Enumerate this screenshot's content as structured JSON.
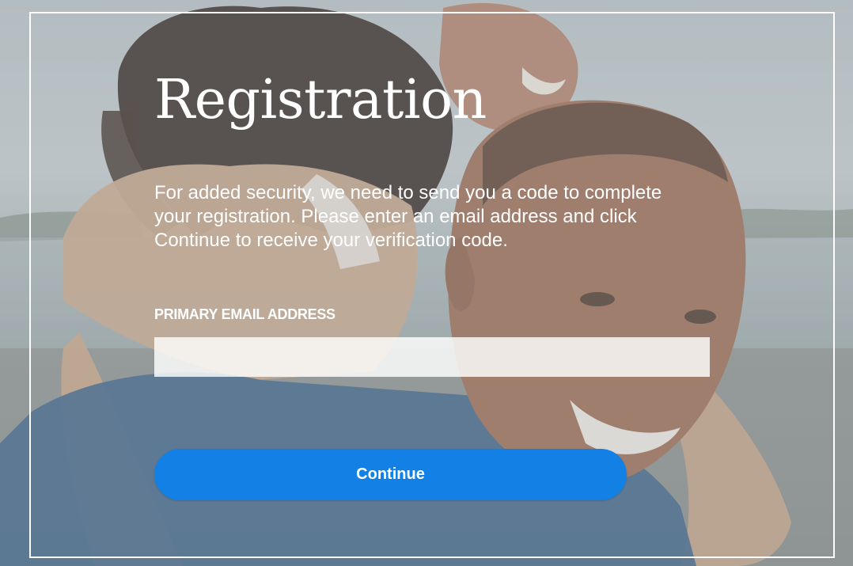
{
  "page": {
    "title": "Registration",
    "description": "For added security, we need to send you a code to complete your registration. Please enter an email address and click Continue to receive your verification code."
  },
  "form": {
    "email_label": "PRIMARY EMAIL ADDRESS",
    "email_value": "",
    "email_placeholder": ""
  },
  "actions": {
    "continue_label": "Continue"
  },
  "colors": {
    "button": "#1380e6",
    "text": "#ffffff",
    "frame": "#ffffff"
  }
}
